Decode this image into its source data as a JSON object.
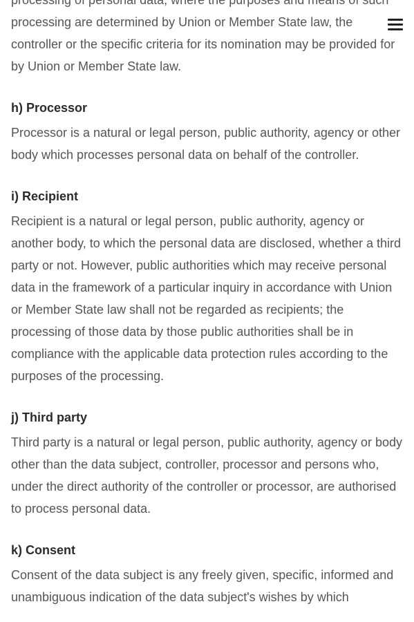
{
  "intro": {
    "text": "processing of personal data, where the purposes and means of such processing are determined by Union or Member State law, the controller or the specific criteria for its nomination may be provided for by Union or Member State law."
  },
  "sections": [
    {
      "heading": "h) Processor",
      "body": "Processor is a natural or legal person, public authority, agency or other body which processes personal data on behalf of the controller."
    },
    {
      "heading": "i) Recipient",
      "body": "Recipient is a natural or legal person, public authority, agency or another body, to which the personal data are disclosed, whether a third party or not. However, public authorities which may receive personal data in the framework of a particular inquiry in accordance with Union or Member State law shall not be regarded as recipients; the processing of those data by those public authorities shall be in compliance with the applicable data protection rules according to the purposes of the processing."
    },
    {
      "heading": "j) Third party",
      "body": "Third party is a natural or legal person, public authority, agency or body other than the data subject, controller, processor and persons who, under the direct authority of the controller or processor, are authorised to process personal data."
    },
    {
      "heading": "k) Consent",
      "body": "Consent of the data subject is any freely given, specific, informed and unambiguous indication of the data subject's wishes by which"
    }
  ],
  "menu": {
    "icon": "hamburger-menu-icon"
  }
}
